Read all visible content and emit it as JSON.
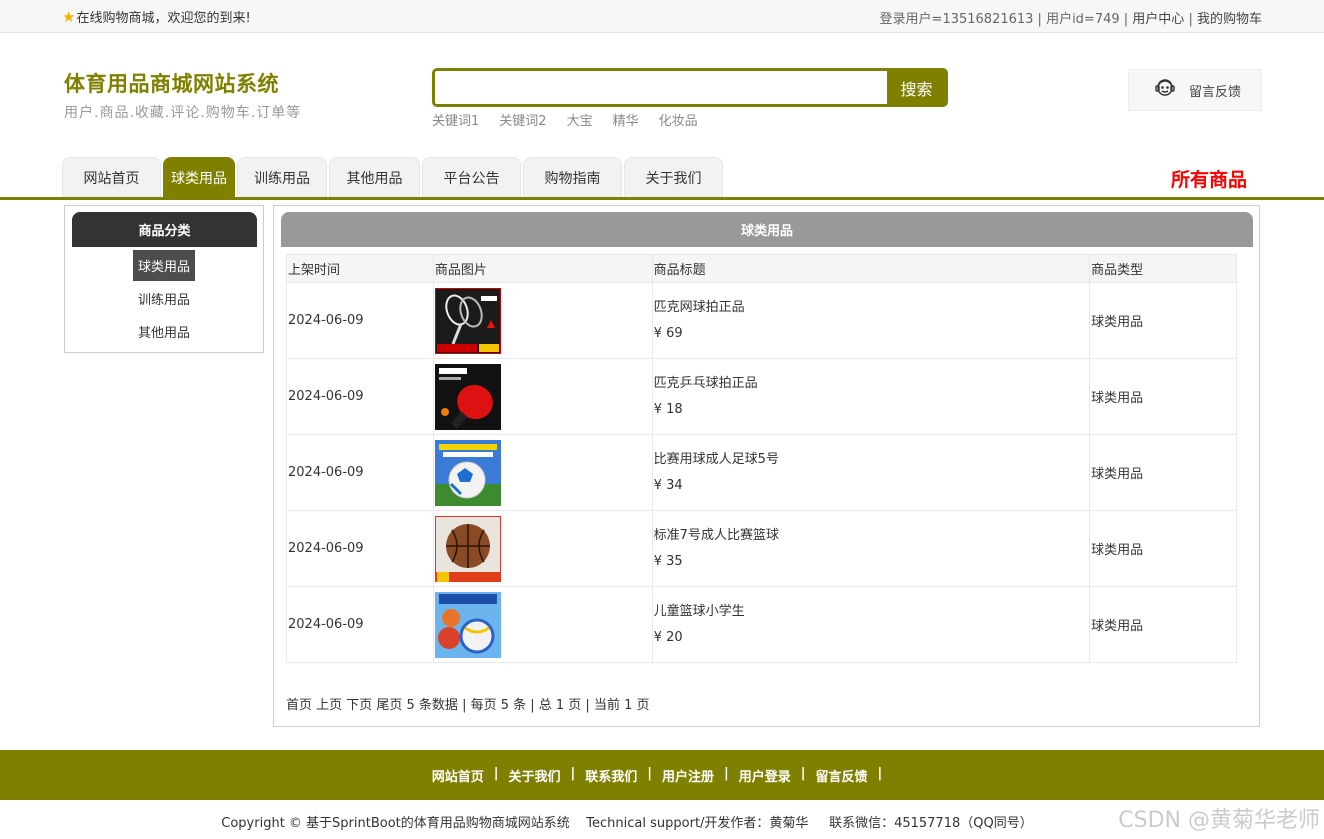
{
  "topbar": {
    "welcome": "在线购物商城，欢迎您的到来!",
    "user_info": "登录用户=13516821613 | 用户id=749 |",
    "user_center": "用户中心",
    "sep": "|",
    "cart": "我的购物车"
  },
  "brand": {
    "title": "体育用品商城网站系统",
    "subtitle": "用户.商品.收藏.评论.购物车.订单等"
  },
  "search": {
    "value": "",
    "button": "搜索",
    "keywords": [
      "关键词1",
      "关键词2",
      "大宝",
      "精华",
      "化妆品"
    ]
  },
  "feedback": {
    "label": "留言反馈"
  },
  "nav": {
    "tabs": [
      {
        "label": "网站首页",
        "active": false
      },
      {
        "label": "球类用品",
        "active": true
      },
      {
        "label": "训练用品",
        "active": false
      },
      {
        "label": "其他用品",
        "active": false
      },
      {
        "label": "平台公告",
        "active": false
      },
      {
        "label": "购物指南",
        "active": false
      },
      {
        "label": "关于我们",
        "active": false
      }
    ],
    "all_goods": "所有商品"
  },
  "sidebar": {
    "title": "商品分类",
    "items": [
      {
        "label": "球类用品",
        "active": true
      },
      {
        "label": "训练用品",
        "active": false
      },
      {
        "label": "其他用品",
        "active": false
      }
    ]
  },
  "main": {
    "title": "球类用品",
    "columns": [
      "上架时间",
      "商品图片",
      "商品标题",
      "商品类型"
    ],
    "rows": [
      {
        "date": "2024-06-09",
        "name": "匹克网球拍正品",
        "price": "¥ 69",
        "type": "球类用品"
      },
      {
        "date": "2024-06-09",
        "name": "匹克乒乓球拍正品",
        "price": "¥ 18",
        "type": "球类用品"
      },
      {
        "date": "2024-06-09",
        "name": "比赛用球成人足球5号",
        "price": "¥ 34",
        "type": "球类用品"
      },
      {
        "date": "2024-06-09",
        "name": "标准7号成人比赛篮球",
        "price": "¥ 35",
        "type": "球类用品"
      },
      {
        "date": "2024-06-09",
        "name": "儿童篮球小学生",
        "price": "¥ 20",
        "type": "球类用品"
      }
    ],
    "pager": "首页 上页 下页 尾页 5 条数据 | 每页 5 条 | 总 1 页 | 当前 1 页"
  },
  "footer": {
    "links": [
      "网站首页",
      "关于我们",
      "联系我们",
      "用户注册",
      "用户登录",
      "留言反馈"
    ],
    "separator": "|",
    "copyright": "Copyright © 基于SprintBoot的体育用品购物商城网站系统    Technical support/开发作者：黄菊华     联系微信：45157718（QQ同号）",
    "watermark": "CSDN @黄菊华老师"
  },
  "colors": {
    "accent": "#808000",
    "highlight": "#ff0000",
    "dark": "#333333",
    "header_gray": "#999999"
  }
}
